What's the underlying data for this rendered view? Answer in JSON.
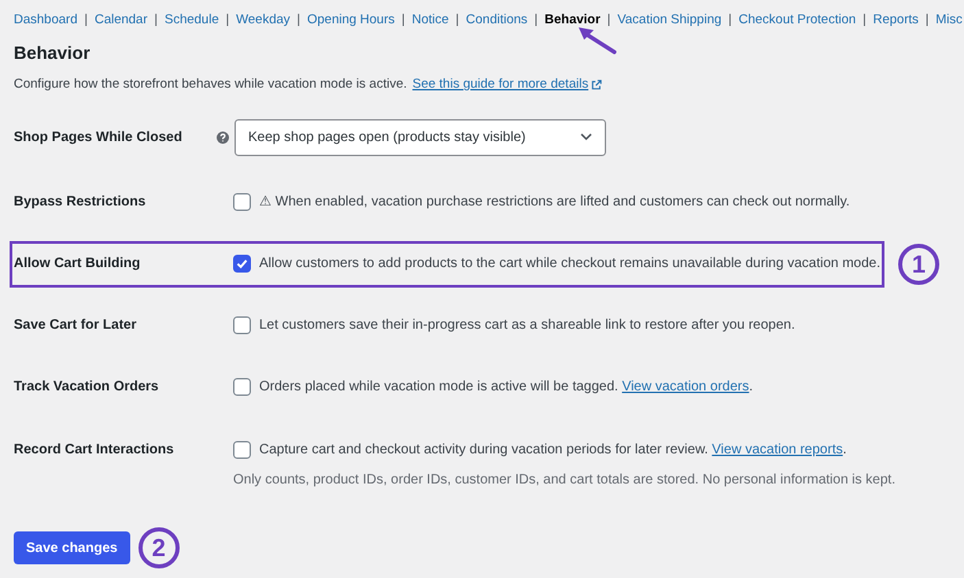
{
  "nav": [
    {
      "label": "Dashboard",
      "selected": false
    },
    {
      "label": "Calendar",
      "selected": false
    },
    {
      "label": "Schedule",
      "selected": false
    },
    {
      "label": "Weekday",
      "selected": false
    },
    {
      "label": "Opening Hours",
      "selected": false
    },
    {
      "label": "Notice",
      "selected": false
    },
    {
      "label": "Conditions",
      "selected": false
    },
    {
      "label": "Behavior",
      "selected": true
    },
    {
      "label": "Vacation Shipping",
      "selected": false
    },
    {
      "label": "Checkout Protection",
      "selected": false
    },
    {
      "label": "Reports",
      "selected": false
    },
    {
      "label": "Misc",
      "selected": false
    }
  ],
  "nav_separator": "|",
  "heading": "Behavior",
  "description": {
    "text": "Configure how the storefront behaves while vacation mode is active.",
    "link": "See this guide for more details"
  },
  "settings": [
    {
      "kind": "select",
      "label": "Shop Pages While Closed",
      "value": "Keep shop pages open (products stay visible)"
    },
    {
      "kind": "checkbox",
      "label": "Bypass Restrictions",
      "checked": false,
      "highlighted": false,
      "text": "⚠ When enabled, vacation purchase restrictions are lifted and customers can check out normally."
    },
    {
      "kind": "checkbox",
      "label": "Allow Cart Building",
      "checked": true,
      "highlighted": true,
      "callout": "1",
      "text": "Allow customers to add products to the cart while checkout remains unavailable during vacation mode."
    },
    {
      "kind": "checkbox",
      "label": "Save Cart for Later",
      "checked": false,
      "highlighted": false,
      "text": "Let customers save their in-progress cart as a shareable link to restore after you reopen."
    },
    {
      "kind": "checkbox",
      "label": "Track Vacation Orders",
      "checked": false,
      "highlighted": false,
      "text": "Orders placed while vacation mode is active will be tagged.",
      "link": "View vacation orders",
      "after": "."
    },
    {
      "kind": "checkbox",
      "label": "Record Cart Interactions",
      "checked": false,
      "highlighted": false,
      "text": "Capture cart and checkout activity during vacation periods for later review.",
      "link": "View vacation reports",
      "after": ".",
      "note": "Only counts, product IDs, order IDs, customer IDs, and cart totals are stored. No personal information is kept."
    }
  ],
  "save_button": {
    "label": "Save changes",
    "callout": "2"
  }
}
